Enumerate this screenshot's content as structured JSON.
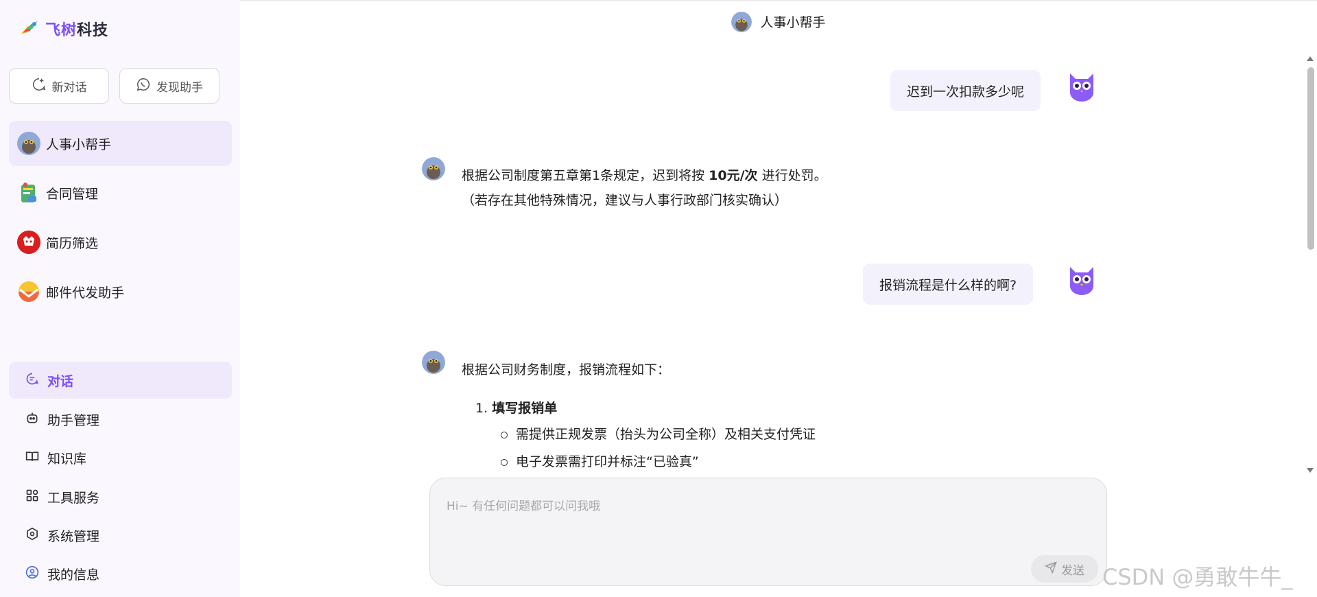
{
  "brand": {
    "name_accent": "飞树",
    "name_rest": "科技"
  },
  "sidebar": {
    "new_chat_label": "新对话",
    "discover_label": "发现助手",
    "assistants": [
      {
        "label": "人事小帮手",
        "icon": "hr-avatar-icon"
      },
      {
        "label": "合同管理",
        "icon": "contract-icon"
      },
      {
        "label": "简历筛选",
        "icon": "resume-icon"
      },
      {
        "label": "邮件代发助手",
        "icon": "mail-icon"
      }
    ],
    "nav": [
      {
        "label": "对话",
        "icon": "chat-icon"
      },
      {
        "label": "助手管理",
        "icon": "robot-icon"
      },
      {
        "label": "知识库",
        "icon": "book-icon"
      },
      {
        "label": "工具服务",
        "icon": "grid-icon"
      },
      {
        "label": "系统管理",
        "icon": "settings-icon"
      },
      {
        "label": "我的信息",
        "icon": "user-icon"
      }
    ]
  },
  "header": {
    "title": "人事小帮手"
  },
  "messages": {
    "q1": "迟到一次扣款多少呢",
    "a1_line1_pre": "根据公司制度第五章第1条规定，迟到将按 ",
    "a1_line1_bold": "10元/次",
    "a1_line1_post": " 进行处罚。",
    "a1_line2": "（若存在其他特殊情况，建议与人事行政部门核实确认）",
    "q2": "报销流程是什么样的啊?",
    "a2_intro": "根据公司财务制度，报销流程如下：",
    "a2_step1_num": "1.",
    "a2_step1_title": "填写报销单",
    "a2_step1_bullets": [
      "需提供正规发票（抬头为公司全称）及相关支付凭证",
      "电子发票需打印并标注“已验真”"
    ]
  },
  "input": {
    "placeholder": "Hi~ 有任何问题都可以问我哦",
    "send_label": "发送"
  },
  "watermark": "CSDN @勇敢牛牛_",
  "colors": {
    "accent": "#7c4dff",
    "active_bg": "#f0e9fc",
    "user_bubble": "#f3f1fb",
    "sidebar_bg": "#faf8fe"
  }
}
